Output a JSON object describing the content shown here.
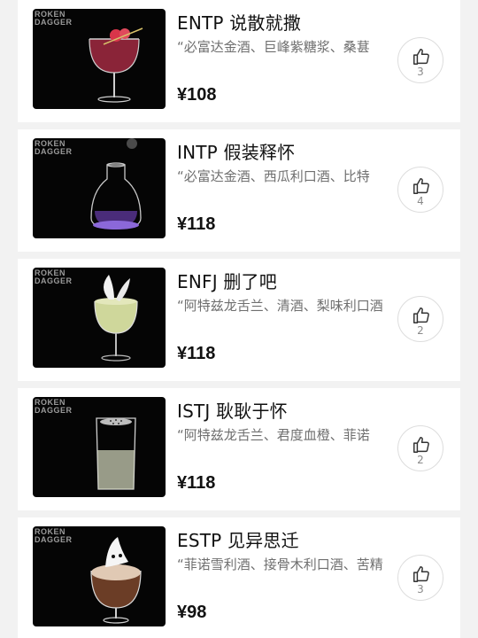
{
  "menu": {
    "items": [
      {
        "title": "ENTP 说散就撒",
        "description": "“必富达金酒、巨峰紫糖浆、桑葚",
        "price": "¥108",
        "likes": "3",
        "image": {
          "logo_top": "ROKEN",
          "logo_bottom": "DAGGER"
        }
      },
      {
        "title": "INTP 假装释怀",
        "description": "“必富达金酒、西瓜利口酒、比特",
        "price": "¥118",
        "likes": "4",
        "image": {
          "logo_top": "ROKEN",
          "logo_bottom": "DAGGER"
        }
      },
      {
        "title": "ENFJ 删了吧",
        "description": "“阿特兹龙舌兰、清酒、梨味利口酒",
        "price": "¥118",
        "likes": "2",
        "image": {
          "logo_top": "ROKEN",
          "logo_bottom": "DAGGER"
        }
      },
      {
        "title": "ISTJ 耿耿于怀",
        "description": "“阿特兹龙舌兰、君度血橙、菲诺",
        "price": "¥118",
        "likes": "2",
        "image": {
          "logo_top": "ROKEN",
          "logo_bottom": "DAGGER"
        }
      },
      {
        "title": "ESTP 见异思迁",
        "description": "“菲诺雪利酒、接骨木利口酒、苦精",
        "price": "¥98",
        "likes": "3",
        "image": {
          "logo_top": "ROKEN",
          "logo_bottom": "DAGGER"
        }
      }
    ]
  },
  "icons": {
    "like": "thumbs-up-icon"
  }
}
